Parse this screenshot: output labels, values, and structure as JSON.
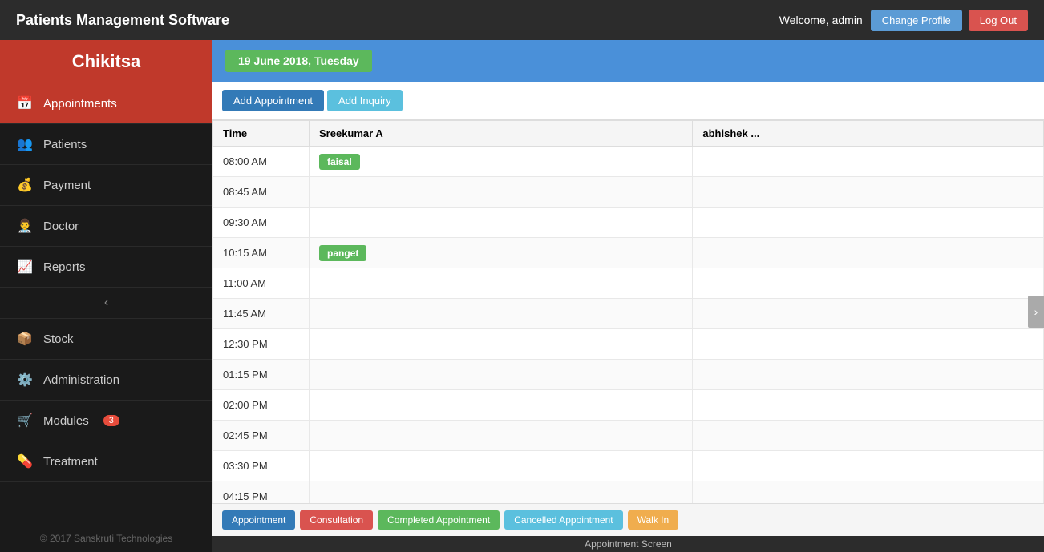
{
  "header": {
    "app_title": "Patients Management Software",
    "welcome_text": "Welcome, admin",
    "change_profile_label": "Change Profile",
    "logout_label": "Log Out"
  },
  "sidebar": {
    "brand": "Chikitsa",
    "items": [
      {
        "id": "appointments",
        "label": "Appointments",
        "icon": "📅",
        "active": true,
        "badge": null
      },
      {
        "id": "patients",
        "label": "Patients",
        "icon": "👥",
        "active": false,
        "badge": null
      },
      {
        "id": "payment",
        "label": "Payment",
        "icon": "💰",
        "active": false,
        "badge": null
      },
      {
        "id": "doctor",
        "label": "Doctor",
        "icon": "👨‍⚕️",
        "active": false,
        "badge": null
      },
      {
        "id": "reports",
        "label": "Reports",
        "icon": "📈",
        "active": false,
        "badge": null
      },
      {
        "id": "stock",
        "label": "Stock",
        "icon": "📦",
        "active": false,
        "badge": null
      },
      {
        "id": "administration",
        "label": "Administration",
        "icon": "⚙️",
        "active": false,
        "badge": null
      },
      {
        "id": "modules",
        "label": "Modules",
        "icon": "🛒",
        "active": false,
        "badge": "3"
      },
      {
        "id": "treatment",
        "label": "Treatment",
        "icon": "💊",
        "active": false,
        "badge": null
      }
    ],
    "footer": "© 2017 Sanskruti Technologies"
  },
  "main": {
    "date_label": "19 June 2018, Tuesday",
    "add_appointment_label": "Add Appointment",
    "add_inquiry_label": "Add Inquiry",
    "columns": [
      "Time",
      "Sreekumar A",
      "abhishek ..."
    ],
    "time_slots": [
      {
        "time": "08:00 AM",
        "col1": "faisal",
        "col1_color": "green",
        "col2": ""
      },
      {
        "time": "08:45 AM",
        "col1": "",
        "col1_color": "",
        "col2": ""
      },
      {
        "time": "09:30 AM",
        "col1": "",
        "col1_color": "",
        "col2": ""
      },
      {
        "time": "10:15 AM",
        "col1": "panget",
        "col1_color": "green",
        "col2": ""
      },
      {
        "time": "11:00 AM",
        "col1": "",
        "col1_color": "",
        "col2": ""
      },
      {
        "time": "11:45 AM",
        "col1": "",
        "col1_color": "",
        "col2": ""
      },
      {
        "time": "12:30 PM",
        "col1": "",
        "col1_color": "",
        "col2": ""
      },
      {
        "time": "01:15 PM",
        "col1": "",
        "col1_color": "",
        "col2": ""
      },
      {
        "time": "02:00 PM",
        "col1": "",
        "col1_color": "",
        "col2": ""
      },
      {
        "time": "02:45 PM",
        "col1": "",
        "col1_color": "",
        "col2": ""
      },
      {
        "time": "03:30 PM",
        "col1": "",
        "col1_color": "",
        "col2": ""
      },
      {
        "time": "04:15 PM",
        "col1": "",
        "col1_color": "",
        "col2": ""
      }
    ],
    "legend_items": [
      {
        "label": "Appointment",
        "color": "blue"
      },
      {
        "label": "Consultation",
        "color": "red"
      },
      {
        "label": "Completed Appointment",
        "color": "green"
      },
      {
        "label": "Cancelled Appointment",
        "color": "teal"
      },
      {
        "label": "Walk In",
        "color": "yellow"
      }
    ],
    "screen_label": "Appointment Screen"
  }
}
